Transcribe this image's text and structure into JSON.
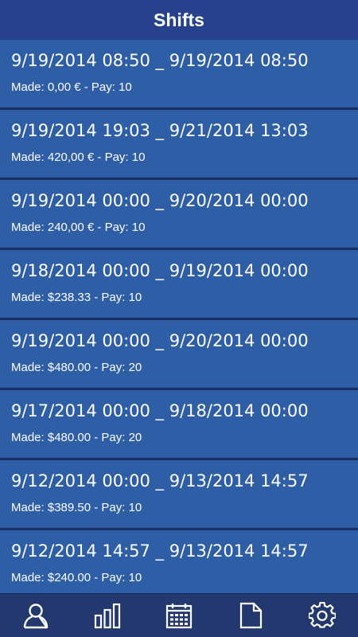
{
  "header": {
    "title": "Shifts"
  },
  "shifts": [
    {
      "range": "9/19/2014 08:50 _ 9/19/2014 08:50",
      "made": "Made: 0,00 € - Pay: 10"
    },
    {
      "range": "9/19/2014 19:03 _ 9/21/2014 13:03",
      "made": "Made: 420,00 € - Pay: 10"
    },
    {
      "range": "9/19/2014 00:00 _ 9/20/2014 00:00",
      "made": "Made: 240,00 € - Pay: 10"
    },
    {
      "range": "9/18/2014 00:00 _ 9/19/2014 00:00",
      "made": "Made: $238.33 - Pay: 10"
    },
    {
      "range": "9/19/2014 00:00 _ 9/20/2014 00:00",
      "made": "Made: $480.00 - Pay: 20"
    },
    {
      "range": "9/17/2014 00:00 _ 9/18/2014 00:00",
      "made": "Made: $480.00 - Pay: 20"
    },
    {
      "range": "9/12/2014 00:00 _ 9/13/2014 14:57",
      "made": "Made: $389.50 - Pay: 10"
    },
    {
      "range": "9/12/2014 14:57 _ 9/13/2014 14:57",
      "made": "Made: $240.00 - Pay: 10"
    }
  ],
  "tabbar": {
    "items": [
      {
        "icon": "user-icon"
      },
      {
        "icon": "bar-chart-icon"
      },
      {
        "icon": "calendar-icon"
      },
      {
        "icon": "document-icon"
      },
      {
        "icon": "gear-icon"
      }
    ]
  },
  "colors": {
    "header_bg": "#27428c",
    "item_bg": "#2e5ea6",
    "tabbar_bg": "#23386e",
    "text": "#ffffff"
  }
}
